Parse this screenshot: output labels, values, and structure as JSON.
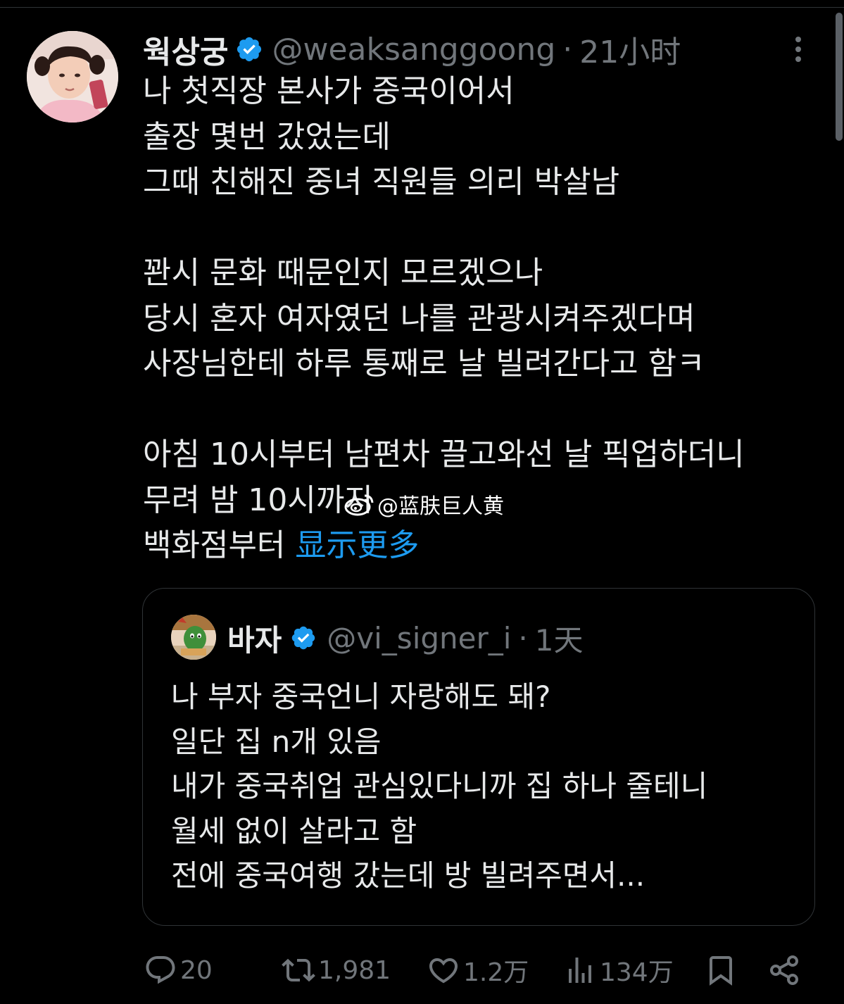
{
  "tweet": {
    "author": {
      "display_name": "웍상궁",
      "handle": "@weaksanggoong",
      "avatar_icon": "avatar-photo-child"
    },
    "separator": "·",
    "time": "21小时",
    "body_lines": [
      "나 첫직장 본사가 중국이어서",
      "출장 몇번 갔었는데",
      "그때 친해진 중녀 직원들 의리 박살남",
      "",
      "꽌시 문화 때문인지 모르겠으나",
      "당시 혼자 여자였던 나를 관광시켜주겠다며",
      "사장님한테 하루 통째로 날 빌려간다고 함ㅋ",
      "",
      "아침 10시부터 남편차 끌고와선 날 픽업하더니",
      "무려 밤 10시까지",
      "백화점부터"
    ],
    "show_more": "显示更多",
    "quote": {
      "author": {
        "display_name": "바자",
        "handle": "@vi_signer_i",
        "avatar_icon": "avatar-illustration"
      },
      "separator": "·",
      "time": "1天",
      "body_lines": [
        "나 부자 중국언니 자랑해도 돼?",
        "일단 집 n개 있음",
        "내가 중국취업 관심있다니까 집 하나 줄테니",
        "월세 없이 살라고 함",
        "전에 중국여행 갔는데 방 빌려주면서..."
      ]
    },
    "actions": {
      "reply": {
        "icon": "reply-icon",
        "count": "20"
      },
      "retweet": {
        "icon": "retweet-icon",
        "count": "1,981"
      },
      "like": {
        "icon": "heart-icon",
        "count": "1.2万"
      },
      "views": {
        "icon": "views-icon",
        "count": "134万"
      },
      "bookmark": {
        "icon": "bookmark-icon"
      },
      "share": {
        "icon": "share-icon"
      }
    }
  },
  "watermark": {
    "text": "@蓝肤巨人黄",
    "icon": "weibo-logo"
  },
  "colors": {
    "background": "#000000",
    "text": "#e7e9ea",
    "muted": "#71767b",
    "link": "#1d9bf0",
    "verified": "#1d9bf0",
    "border": "#2f3336"
  }
}
